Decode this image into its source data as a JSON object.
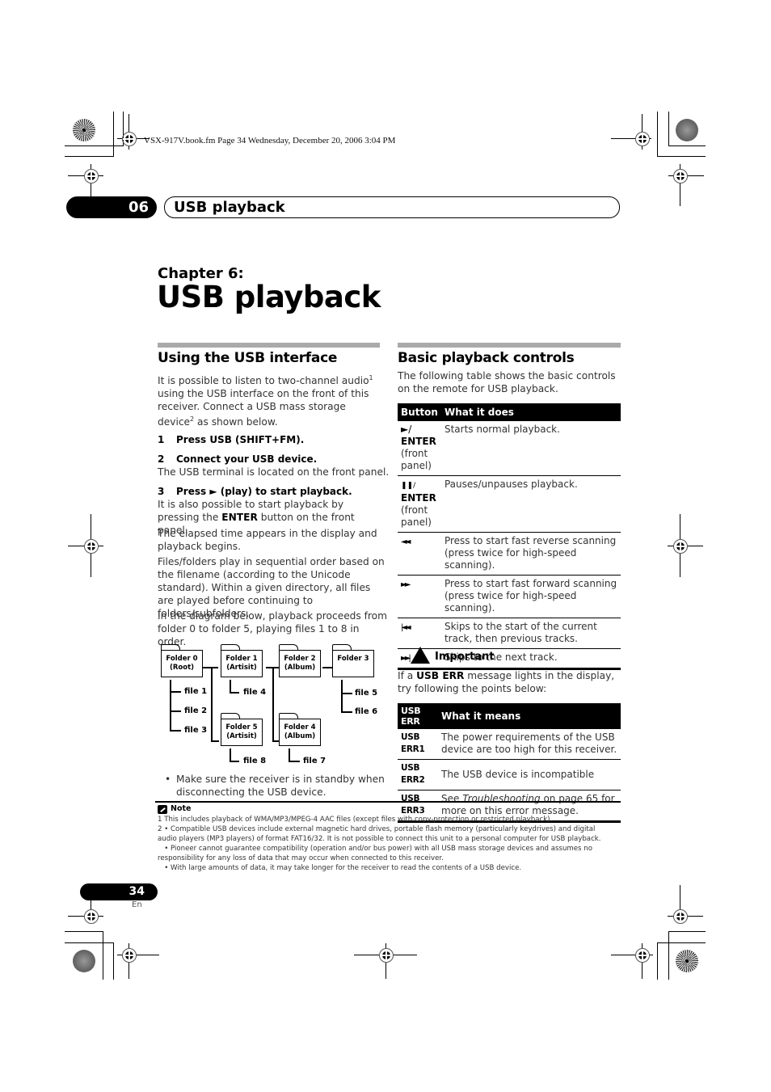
{
  "file_info": "VSX-917V.book.fm  Page 34  Wednesday, December 20, 2006  3:04 PM",
  "header": {
    "chapter_number": "06",
    "chapter_tab_title": "USB playback"
  },
  "chapter": {
    "label": "Chapter 6:",
    "title": "USB playback"
  },
  "left_section": {
    "heading": "Using the USB interface",
    "intro": [
      "It is possible to listen to two-channel audio",
      "1",
      " using the USB interface on the front of this receiver. Connect a USB mass storage device",
      "2",
      " as shown below."
    ],
    "steps": [
      {
        "num": "1",
        "text": "Press USB (SHIFT+FM)."
      },
      {
        "num": "2",
        "text": "Connect your USB device."
      },
      {
        "num": "3",
        "text": "Press ► (play) to start playback."
      }
    ],
    "step2_body": "The USB terminal is located on the front panel.",
    "step3_body_pre": "It is also possible to start playback by pressing the ",
    "step3_body_bold": "ENTER",
    "step3_body_post": " button on the front panel.",
    "para_elapsed": "The elapsed time appears in the display and playback begins.",
    "para_order": "Files/folders play in sequential order based on the filename (according to the Unicode standard). Within a given directory, all files are played before continuing to folders/subfolders.",
    "para_diagram": "In the diagram below, playback proceeds from folder 0 to folder 5, playing files 1 to 8 in order.",
    "bullet": "Make sure the receiver is in standby when disconnecting the USB device."
  },
  "diagram": {
    "folders": [
      {
        "line1": "Folder 0",
        "line2": "(Root)"
      },
      {
        "line1": "Folder 1",
        "line2": "(Artisit)"
      },
      {
        "line1": "Folder 2",
        "line2": "(Album)"
      },
      {
        "line1": "Folder 3",
        "line2": ""
      },
      {
        "line1": "Folder 5",
        "line2": "(Artisit)"
      },
      {
        "line1": "Folder 4",
        "line2": "(Album)"
      }
    ],
    "files": [
      "file 1",
      "file 2",
      "file 3",
      "file 4",
      "file 5",
      "file 6",
      "file 7",
      "file 8"
    ]
  },
  "right_section": {
    "heading": "Basic playback controls",
    "intro": "The following table shows the basic controls on the remote for USB playback.",
    "table": {
      "headers": [
        "Button",
        "What it does"
      ],
      "rows": [
        {
          "symbol": "►/",
          "bold": "ENTER",
          "extra": "(front panel)",
          "desc": "Starts normal playback."
        },
        {
          "symbol": "❚❚/",
          "bold": "ENTER",
          "extra": "(front panel)",
          "desc": "Pauses/unpauses playback."
        },
        {
          "symbol": "◄◄",
          "bold": "",
          "extra": "",
          "desc": "Press to start fast reverse scanning (press twice for high-speed scanning)."
        },
        {
          "symbol": "►►",
          "bold": "",
          "extra": "",
          "desc": "Press to start fast forward scanning (press twice for high-speed scanning)."
        },
        {
          "symbol": "|◄◄",
          "bold": "",
          "extra": "",
          "desc": "Skips to the start of the current track, then previous tracks."
        },
        {
          "symbol": "►►|",
          "bold": "",
          "extra": "",
          "desc": "Skips to the next track."
        }
      ]
    },
    "important_label": "Important",
    "important_pre": "If a ",
    "important_bold": "USB ERR",
    "important_post": " message lights in the display, try following the points below:",
    "err_table": {
      "headers": [
        "USB ERR",
        "What it means"
      ],
      "rows": [
        {
          "code": "USB ERR1",
          "desc": "The power requirements of the USB device are too high for this receiver."
        },
        {
          "code": "USB ERR2",
          "desc": "The USB device is incompatible"
        },
        {
          "code": "USB ERR3",
          "desc_pre": "See ",
          "desc_italic": "Troubleshooting",
          "desc_post": " on page 65 for more on this error message."
        }
      ]
    }
  },
  "notes": {
    "label": "Note",
    "lines": [
      "1 This includes playback of WMA/MP3/MPEG-4 AAC files (except files with copy-protection or restricted playback).",
      "2  • Compatible USB devices include external magnetic hard drives, portable flash memory (particularly keydrives) and digital",
      "audio players (MP3 players) of format FAT16/32. It is not possible to connect this unit to a personal computer for USB playback.",
      "   • Pioneer cannot guarantee compatibility (operation and/or bus power) with all USB mass storage devices and assumes no",
      "responsibility for any loss of data that may occur when connected to this receiver.",
      "   • With large amounts of data, it may take longer for the receiver to read the contents of a USB device."
    ]
  },
  "footer": {
    "page_number": "34",
    "language": "En"
  }
}
